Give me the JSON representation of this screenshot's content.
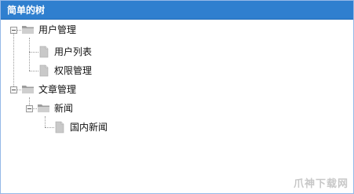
{
  "header": {
    "title": "简单的树"
  },
  "tree": {
    "user_mgmt": {
      "label": "用户管理",
      "expanded": true,
      "icon": "folder-open-icon"
    },
    "user_list": {
      "label": "用户列表",
      "icon": "file-icon"
    },
    "permission_mgmt": {
      "label": "权限管理",
      "icon": "file-icon"
    },
    "article_mgmt": {
      "label": "文章管理",
      "expanded": true,
      "icon": "folder-open-icon"
    },
    "news": {
      "label": "新闻",
      "expanded": true,
      "icon": "folder-open-icon"
    },
    "domestic_news": {
      "label": "国内新闻",
      "icon": "file-icon"
    }
  },
  "watermark": {
    "text": "爪神下载网"
  },
  "colors": {
    "header_bg": "#2f7fcf",
    "border": "#95b8e7"
  }
}
